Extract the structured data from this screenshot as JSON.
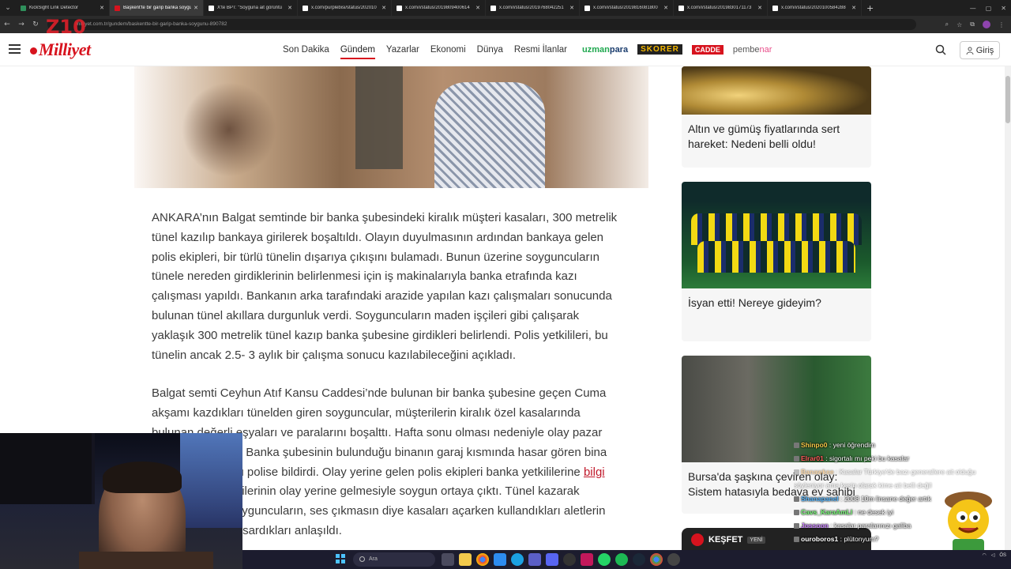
{
  "browser": {
    "tabs": [
      {
        "title": "KickSight Link Detector",
        "color": "#2f8f5b",
        "active": false
      },
      {
        "title": "Başkent'te bir garip banka soygunu",
        "color": "#d7131e",
        "active": true
      },
      {
        "title": "X'te BPT: \"Soyguna ait görüntü",
        "color": "#ffffff",
        "active": false
      },
      {
        "title": "x.com/purplebisi/status/202010",
        "color": "#ffffff",
        "active": false
      },
      {
        "title": "x.com/i/status/2019809400614",
        "color": "#ffffff",
        "active": false
      },
      {
        "title": "x.com/i/status/2019768042251",
        "color": "#ffffff",
        "active": false
      },
      {
        "title": "x.com/i/status/2019816081800",
        "color": "#ffffff",
        "active": false
      },
      {
        "title": "x.com/i/status/2019830171173",
        "color": "#ffffff",
        "active": false
      },
      {
        "title": "x.com/i/status/2020100584288",
        "color": "#ffffff",
        "active": false
      }
    ],
    "url": "milliyet.com.tr/gundem/baskentte-bir-garip-banka-soygunu-890782"
  },
  "header": {
    "logo_text": "Milliyet",
    "overlay_logo": "Z10",
    "nav": [
      "Son Dakika",
      "Gündem",
      "Yazarlar",
      "Ekonomi",
      "Dünya",
      "Resmi İlanlar"
    ],
    "active_nav": "Gündem",
    "brands": {
      "uzmanpara_prefix": "uzman",
      "uzmanpara_suffix": "para",
      "skorer": "SKORER",
      "cadde": "CADDE",
      "pembenar_prefix": "pembe",
      "pembenar_suffix": "nar"
    },
    "login_label": "Giriş"
  },
  "article": {
    "p1": "ANKARA’nın Balgat semtinde bir banka şubesindeki kiralık müşteri kasaları, 300 metrelik tünel kazılıp bankaya girilerek boşaltıldı. Olayın duyulmasının ardından bankaya gelen polis ekipleri, bir türlü tünelin dışarıya çıkışını bulamadı. Bunun üzerine soyguncuların tünele nereden girdiklerinin belirlenmesi için iş makinalarıyla banka etrafında kazı çalışması yapıldı. Bankanın arka tarafındaki arazide yapılan kazı çalışmaları sonucunda bulunan tünel akıllara durgunluk verdi. Soyguncuların maden işçileri gibi çalışarak yaklaşık 300 metrelik tünel kazıp banka şubesine girdikleri belirlendi. Polis yetkilileri, bu tünelin ancak 2.5- 3 aylık bir çalışma sonucu kazılabileceğini açıkladı.",
    "p2_before_link": "Balgat semti Ceyhun Atıf Kansu Caddesi’nde bulunan bir banka şubesine geçen Cuma akşamı kazdıkları tünelden giren soyguncular, müşterilerin kiralık özel kasalarında bulunan değerli eşyaları ve paralarını boşalttı. Hafta sonu olması nedeniyle olay pazar günü ortaya çıktı. Banka şubesinin bulunduğu binanın garaj kısmında hasar gören bina yöneticisi durumu polise bildirdi. Olay yerine gelen polis ekipleri banka yetkililerine ",
    "p2_link": "bilgi",
    "p2_after_link": " verdi. Şube yetkililerinin olay yerine gelmesiyle soygun ortaya çıktı. Tünel kazarak bankaya giren soyguncuların, ses çıkmasın diye kasaları açarken kullandıkları aletlerin başlarına pamuk sardıkları anlaşıldı."
  },
  "sidebar": {
    "cards": [
      {
        "title": "Altın ve gümüş fiyatlarında sert hareket: Nedeni belli oldu!"
      },
      {
        "title": "İsyan etti! Nereye gideyim?"
      },
      {
        "title": "Bursa'da şaşkına çeviren olay: Sistem hatasıyla bedava ev sahibi"
      }
    ],
    "kesfet_label": "KEŞFET",
    "kesfet_badge": "YENİ"
  },
  "chat": [
    {
      "user": "Shinpo0",
      "msg": "yeni öğrendim",
      "color": "#f7c948",
      "faded": false
    },
    {
      "user": "Elrar01",
      "msg": "sigortalı mı peki bu kasalar",
      "color": "#ff5c5c",
      "faded": false
    },
    {
      "user": "Banawkee",
      "msg": "Kasalar Türkiye'de bazı generallere ait olduğu",
      "color": "#f2a33a",
      "faded": true
    },
    {
      "user": "",
      "msg": "söyleniyor ama kesin olarak kime ait belli değil",
      "color": "#ffffff",
      "faded": true
    },
    {
      "user": "Shanapanel",
      "msg": "2008 10m linsane değer artık",
      "color": "#59b8ff",
      "faded": false
    },
    {
      "user": "Cavs_KaraAmLl",
      "msg": "ne desek iyi",
      "color": "#7cfc7c",
      "faded": false
    },
    {
      "user": "Jossoon",
      "msg": "kasalar paralarınızı galiba",
      "color": "#c77dff",
      "faded": false
    },
    {
      "user": "ouroboros1",
      "msg": "plütonyum?",
      "color": "#ffffff",
      "faded": false
    }
  ],
  "taskbar": {
    "search_placeholder": "Ara",
    "tray_text": "ÖS"
  }
}
